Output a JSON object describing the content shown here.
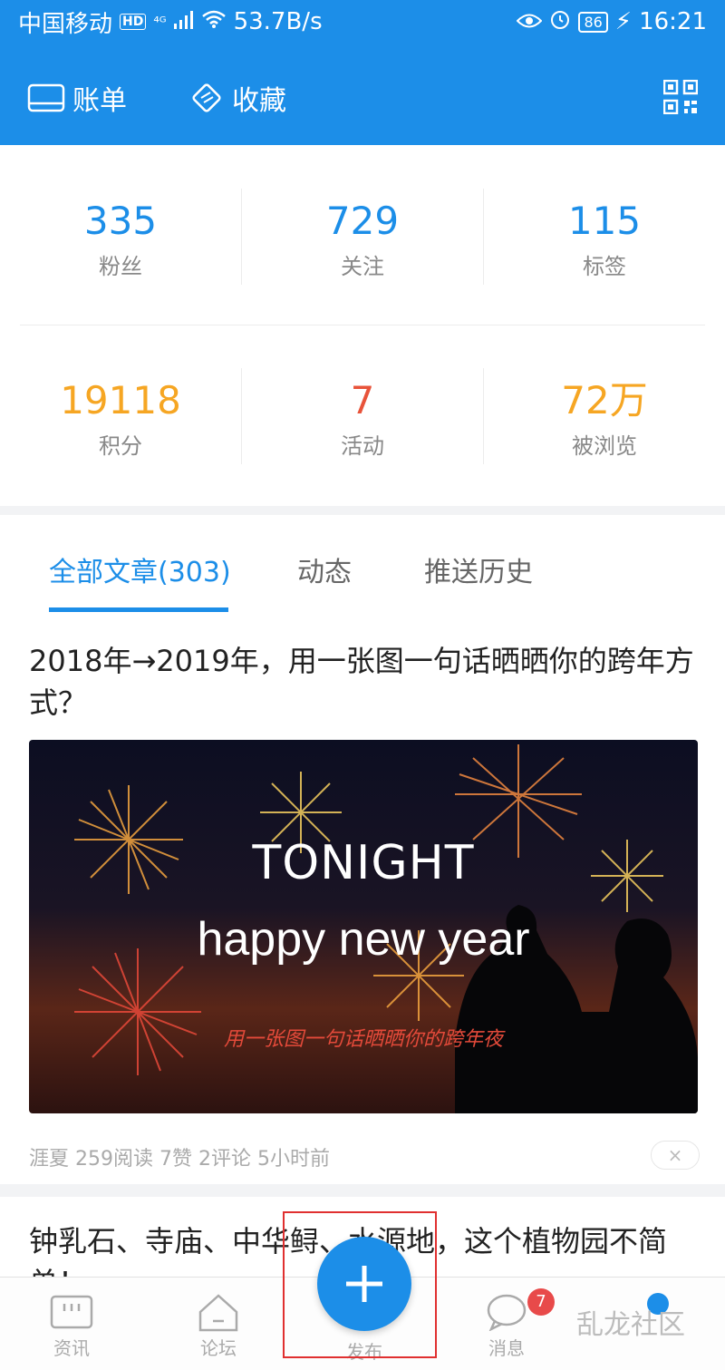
{
  "status_bar": {
    "carrier": "中国移动",
    "hd": "HD",
    "signal": "⁴ᴳ",
    "speed": "53.7B/s",
    "battery": "86",
    "time": "16:21"
  },
  "toolbar": {
    "bill_label": "账单",
    "favorites_label": "收藏"
  },
  "stats": {
    "fans": {
      "value": "335",
      "label": "粉丝"
    },
    "following": {
      "value": "729",
      "label": "关注"
    },
    "tags": {
      "value": "115",
      "label": "标签"
    },
    "points": {
      "value": "19118",
      "label": "积分"
    },
    "events": {
      "value": "7",
      "label": "活动"
    },
    "views": {
      "value": "72万",
      "label": "被浏览"
    }
  },
  "colors": {
    "primary": "#1c8ee8",
    "points": "#f6a623",
    "events": "#e8533a",
    "views": "#f6a623"
  },
  "tabs": [
    {
      "label": "全部文章(303)",
      "active": true
    },
    {
      "label": "动态",
      "active": false
    },
    {
      "label": "推送历史",
      "active": false
    }
  ],
  "articles": [
    {
      "title": "2018年→2019年，用一张图一句话晒晒你的跨年方式？",
      "banner": {
        "line1": "TONIGHT",
        "line2": "happy  new year",
        "line3": "用一张图一句话晒晒你的跨年夜"
      },
      "meta": "涯夏 259阅读 7赞 2评论 5小时前",
      "close_label": "×"
    },
    {
      "title": "钟乳石、寺庙、中华鲟、水源地，这个植物园不简单！"
    }
  ],
  "bottom_nav": {
    "news": "资讯",
    "forum": "论坛",
    "publish": "发布",
    "messages": "消息",
    "messages_badge": "7"
  },
  "watermark": "乱龙社区"
}
